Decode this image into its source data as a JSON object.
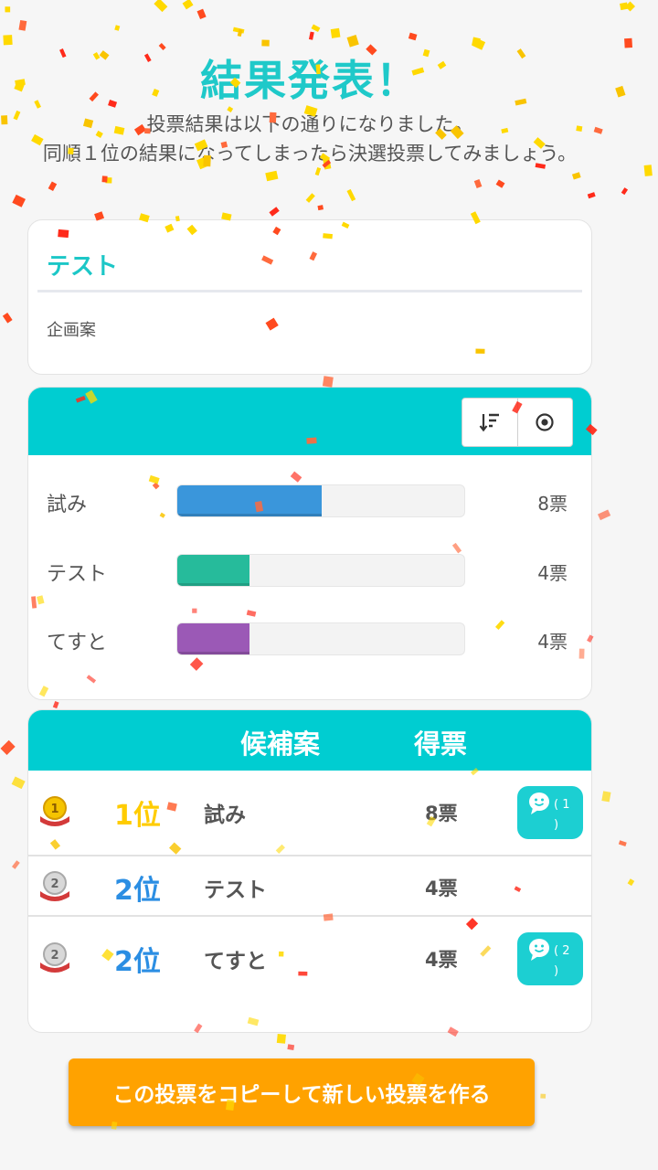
{
  "header": {
    "title": "結果発表！",
    "description_line1": "投票結果は以下の通りになりました。",
    "description_line2": "同順１位の結果になってしまったら決選投票してみましょう。"
  },
  "poll": {
    "title": "テスト",
    "subtitle": "企画案"
  },
  "chart_toolbar": {
    "sort_icon": "sort-descending-icon",
    "target_icon": "radio-target-icon"
  },
  "chart_data": {
    "type": "bar",
    "orientation": "horizontal",
    "categories": [
      "試み",
      "テスト",
      "てすと"
    ],
    "values": [
      8,
      4,
      4
    ],
    "value_labels": [
      "8票",
      "4票",
      "4票"
    ],
    "xlim": [
      0,
      16
    ],
    "colors": [
      "#3a96db",
      "#26bb9b",
      "#9b59b6"
    ]
  },
  "ranking": {
    "headers": {
      "candidate": "候補案",
      "votes": "得票"
    },
    "rows": [
      {
        "medal": "gold-medal-icon",
        "medal_num": "1",
        "rank": "1位",
        "rank_color": "#ffcc00",
        "candidate": "試み",
        "votes": "8票",
        "comment": "( 1 )",
        "has_comment": true
      },
      {
        "medal": "silver-medal-icon",
        "medal_num": "2",
        "rank": "2位",
        "rank_color": "#2b8ee3",
        "candidate": "テスト",
        "votes": "4票",
        "comment": "",
        "has_comment": false
      },
      {
        "medal": "silver-medal-icon",
        "medal_num": "2",
        "rank": "2位",
        "rank_color": "#2b8ee3",
        "candidate": "てすと",
        "votes": "4票",
        "comment": "( 2 )",
        "has_comment": true
      }
    ]
  },
  "actions": {
    "copy_label": "この投票をコピーして新しい投票を作る"
  },
  "colors": {
    "accent": "#00cdd1",
    "title": "#1fc9c9",
    "button": "#ffa200"
  }
}
